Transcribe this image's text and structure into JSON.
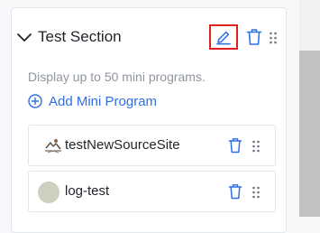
{
  "section": {
    "title": "Test Section",
    "description": "Display up to 50 mini programs.",
    "add_label": "Add Mini Program"
  },
  "items": [
    {
      "label": "testNewSourceSite",
      "thumb": "image-thumb-icon"
    },
    {
      "label": "log-test",
      "thumb": "avatar"
    }
  ],
  "icons": {
    "collapse": "chevron-down-icon",
    "edit": "pencil-icon",
    "delete": "trash-icon",
    "drag": "drag-handle-icon",
    "add": "plus-circle-icon"
  },
  "colors": {
    "accent": "#2f6fe4",
    "highlight_border": "#e0201e",
    "text_primary": "#1f2329",
    "text_secondary": "#8f959e"
  }
}
